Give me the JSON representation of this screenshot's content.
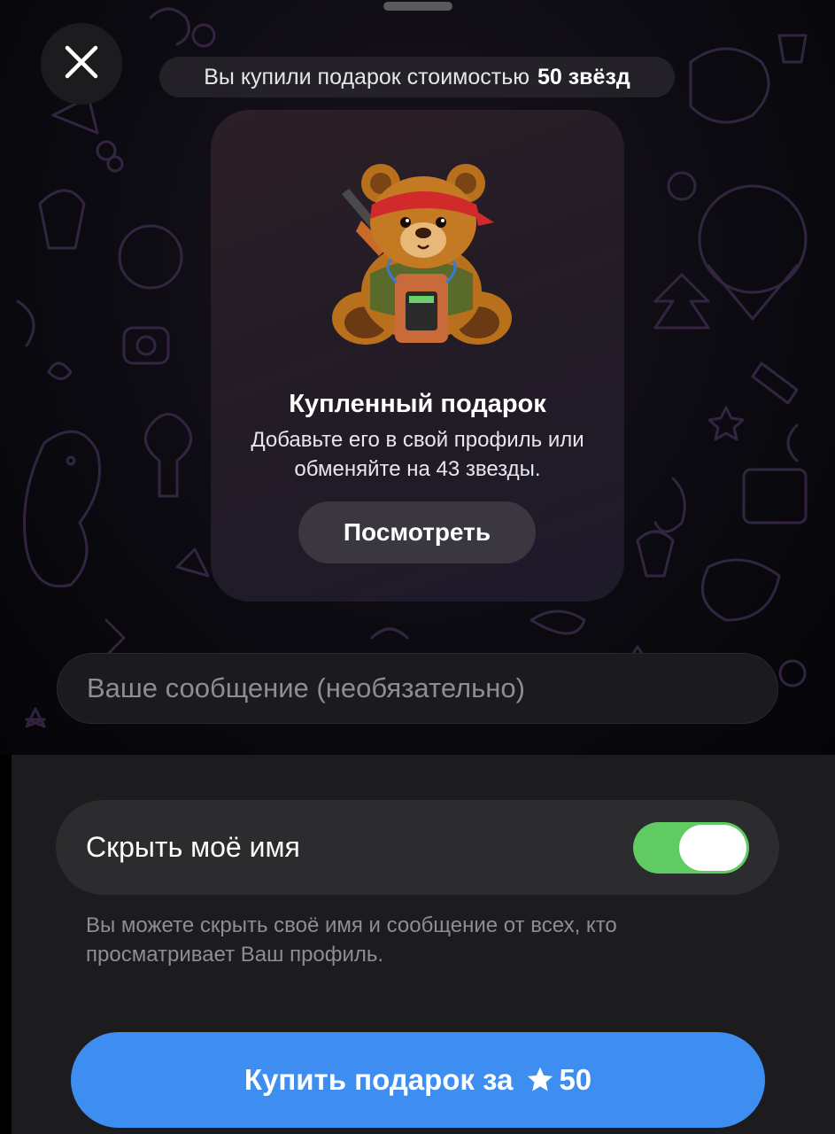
{
  "header": {
    "close_icon": "close-icon",
    "banner_prefix": "Вы купили подарок стоимостью",
    "banner_amount": "50 звёзд"
  },
  "gift_card": {
    "title": "Купленный подарок",
    "description": "Добавьте его в свой профиль или обменяйте на 43 звезды.",
    "view_label": "Посмотреть",
    "image_icon": "teddy-bear-gift-icon"
  },
  "message": {
    "placeholder": "Ваше сообщение (необязательно)"
  },
  "hide_name": {
    "label": "Скрыть моё имя",
    "enabled": true,
    "toggle_color": "#5fcb62",
    "hint": "Вы можете скрыть своё имя и сообщение от всех, кто просматривает Ваш профиль."
  },
  "buy": {
    "label": "Купить подарок за",
    "amount": "50",
    "star_icon": "star-icon",
    "color": "#3d8ef0"
  }
}
